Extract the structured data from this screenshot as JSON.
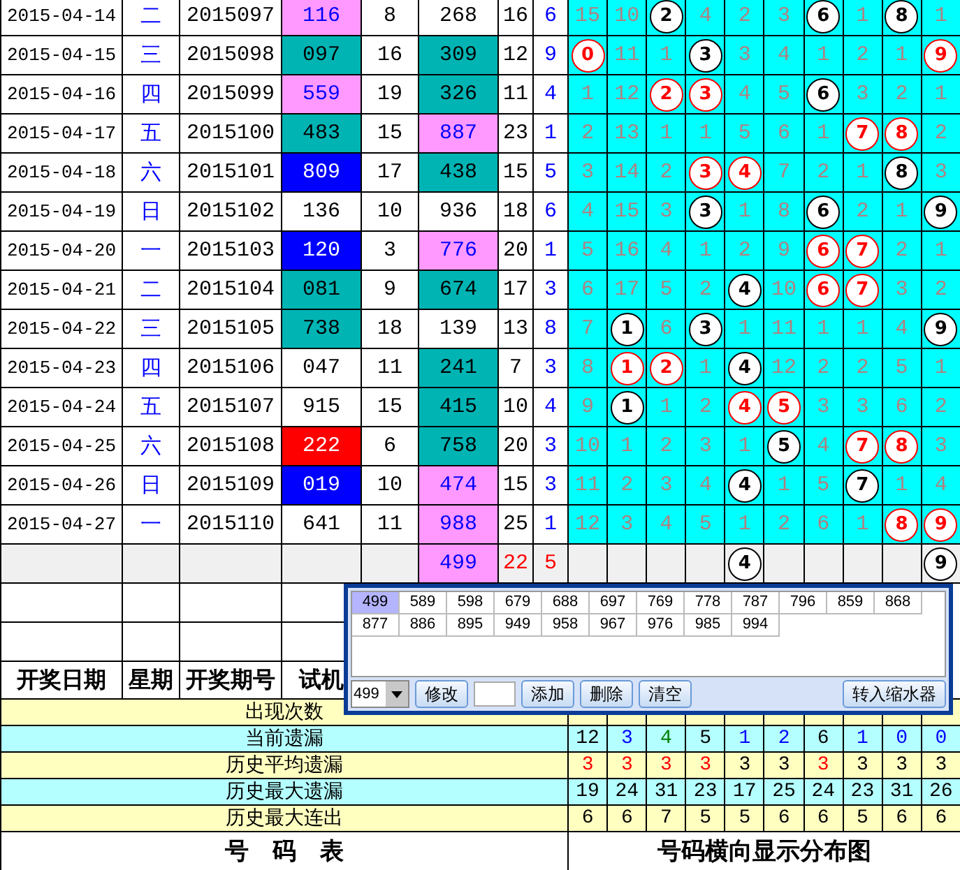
{
  "rows": [
    {
      "date": "2015-04-14",
      "weekday": "二",
      "period": "2015097",
      "trial": {
        "text": "116",
        "color": "#ff99ff"
      },
      "column_5": "8",
      "column_6": {
        "text": "268"
      },
      "column_7": "16",
      "column_8": "6",
      "digits": [
        {
          "text": "15",
          "kind": "miss"
        },
        {
          "text": "10",
          "kind": "miss"
        },
        {
          "text": "2",
          "kind": "ball"
        },
        {
          "text": "4",
          "kind": "miss"
        },
        {
          "text": "2",
          "kind": "miss"
        },
        {
          "text": "3",
          "kind": "miss"
        },
        {
          "text": "6",
          "kind": "ball"
        },
        {
          "text": "1",
          "kind": "miss"
        },
        {
          "text": "8",
          "kind": "ball"
        },
        {
          "text": "1",
          "kind": "miss"
        }
      ]
    },
    {
      "date": "2015-04-15",
      "weekday": "三",
      "period": "2015098",
      "trial": {
        "text": "097",
        "color": "#00b4b4"
      },
      "column_5": "16",
      "column_6": {
        "text": "309",
        "color": "#00b4b4"
      },
      "column_7": "12",
      "column_8": "9",
      "digits": [
        {
          "text": "0",
          "kind": "red-ball"
        },
        {
          "text": "11",
          "kind": "miss"
        },
        {
          "text": "1",
          "kind": "miss"
        },
        {
          "text": "3",
          "kind": "ball"
        },
        {
          "text": "3",
          "kind": "miss"
        },
        {
          "text": "4",
          "kind": "miss"
        },
        {
          "text": "1",
          "kind": "miss"
        },
        {
          "text": "2",
          "kind": "miss"
        },
        {
          "text": "1",
          "kind": "miss"
        },
        {
          "text": "9",
          "kind": "red-ball"
        }
      ]
    },
    {
      "date": "2015-04-16",
      "weekday": "四",
      "period": "2015099",
      "trial": {
        "text": "559",
        "color": "#ff99ff"
      },
      "column_5": "19",
      "column_6": {
        "text": "326",
        "color": "#00b4b4"
      },
      "column_7": "11",
      "column_8": "4",
      "digits": [
        {
          "text": "1",
          "kind": "miss"
        },
        {
          "text": "12",
          "kind": "miss"
        },
        {
          "text": "2",
          "kind": "red-ball"
        },
        {
          "text": "3",
          "kind": "red-ball"
        },
        {
          "text": "4",
          "kind": "miss"
        },
        {
          "text": "5",
          "kind": "miss"
        },
        {
          "text": "6",
          "kind": "ball"
        },
        {
          "text": "3",
          "kind": "miss"
        },
        {
          "text": "2",
          "kind": "miss"
        },
        {
          "text": "1",
          "kind": "miss"
        }
      ]
    },
    {
      "date": "2015-04-17",
      "weekday": "五",
      "period": "2015100",
      "trial": {
        "text": "483",
        "color": "#00b4b4"
      },
      "column_5": "15",
      "column_6": {
        "text": "887",
        "color": "#ff99ff"
      },
      "column_7": "23",
      "column_8": "1",
      "digits": [
        {
          "text": "2",
          "kind": "miss"
        },
        {
          "text": "13",
          "kind": "miss"
        },
        {
          "text": "1",
          "kind": "miss"
        },
        {
          "text": "1",
          "kind": "miss"
        },
        {
          "text": "5",
          "kind": "miss"
        },
        {
          "text": "6",
          "kind": "miss"
        },
        {
          "text": "1",
          "kind": "miss"
        },
        {
          "text": "7",
          "kind": "red-ball"
        },
        {
          "text": "8",
          "kind": "red-ball"
        },
        {
          "text": "2",
          "kind": "miss"
        }
      ]
    },
    {
      "date": "2015-04-18",
      "weekday": "六",
      "period": "2015101",
      "trial": {
        "text": "809",
        "color": "#0000ff"
      },
      "column_5": "17",
      "column_6": {
        "text": "438",
        "color": "#00b4b4"
      },
      "column_7": "15",
      "column_8": "5",
      "digits": [
        {
          "text": "3",
          "kind": "miss"
        },
        {
          "text": "14",
          "kind": "miss"
        },
        {
          "text": "2",
          "kind": "miss"
        },
        {
          "text": "3",
          "kind": "red-ball"
        },
        {
          "text": "4",
          "kind": "red-ball"
        },
        {
          "text": "7",
          "kind": "miss"
        },
        {
          "text": "2",
          "kind": "miss"
        },
        {
          "text": "1",
          "kind": "miss"
        },
        {
          "text": "8",
          "kind": "ball"
        },
        {
          "text": "3",
          "kind": "miss"
        }
      ]
    },
    {
      "date": "2015-04-19",
      "weekday": "日",
      "period": "2015102",
      "trial": {
        "text": "136"
      },
      "column_5": "10",
      "column_6": {
        "text": "936"
      },
      "column_7": "18",
      "column_8": "6",
      "digits": [
        {
          "text": "4",
          "kind": "miss"
        },
        {
          "text": "15",
          "kind": "miss"
        },
        {
          "text": "3",
          "kind": "miss"
        },
        {
          "text": "3",
          "kind": "ball"
        },
        {
          "text": "1",
          "kind": "miss"
        },
        {
          "text": "8",
          "kind": "miss"
        },
        {
          "text": "6",
          "kind": "ball"
        },
        {
          "text": "2",
          "kind": "miss"
        },
        {
          "text": "1",
          "kind": "miss"
        },
        {
          "text": "9",
          "kind": "ball"
        }
      ]
    },
    {
      "date": "2015-04-20",
      "weekday": "一",
      "period": "2015103",
      "trial": {
        "text": "120",
        "color": "#0000ff"
      },
      "column_5": "3",
      "column_6": {
        "text": "776",
        "color": "#ff99ff"
      },
      "column_7": "20",
      "column_8": "1",
      "digits": [
        {
          "text": "5",
          "kind": "miss"
        },
        {
          "text": "16",
          "kind": "miss"
        },
        {
          "text": "4",
          "kind": "miss"
        },
        {
          "text": "1",
          "kind": "miss"
        },
        {
          "text": "2",
          "kind": "miss"
        },
        {
          "text": "9",
          "kind": "miss"
        },
        {
          "text": "6",
          "kind": "red-ball"
        },
        {
          "text": "7",
          "kind": "red-ball"
        },
        {
          "text": "2",
          "kind": "miss"
        },
        {
          "text": "1",
          "kind": "miss"
        }
      ]
    },
    {
      "date": "2015-04-21",
      "weekday": "二",
      "period": "2015104",
      "trial": {
        "text": "081",
        "color": "#00b4b4"
      },
      "column_5": "9",
      "column_6": {
        "text": "674",
        "color": "#00b4b4"
      },
      "column_7": "17",
      "column_8": "3",
      "digits": [
        {
          "text": "6",
          "kind": "miss"
        },
        {
          "text": "17",
          "kind": "miss"
        },
        {
          "text": "5",
          "kind": "miss"
        },
        {
          "text": "2",
          "kind": "miss"
        },
        {
          "text": "4",
          "kind": "ball"
        },
        {
          "text": "10",
          "kind": "miss"
        },
        {
          "text": "6",
          "kind": "red-ball"
        },
        {
          "text": "7",
          "kind": "red-ball"
        },
        {
          "text": "3",
          "kind": "miss"
        },
        {
          "text": "2",
          "kind": "miss"
        }
      ]
    },
    {
      "date": "2015-04-22",
      "weekday": "三",
      "period": "2015105",
      "trial": {
        "text": "738",
        "color": "#00b4b4"
      },
      "column_5": "18",
      "column_6": {
        "text": "139"
      },
      "column_7": "13",
      "column_8": "8",
      "digits": [
        {
          "text": "7",
          "kind": "miss"
        },
        {
          "text": "1",
          "kind": "ball"
        },
        {
          "text": "6",
          "kind": "miss"
        },
        {
          "text": "3",
          "kind": "ball"
        },
        {
          "text": "1",
          "kind": "miss"
        },
        {
          "text": "11",
          "kind": "miss"
        },
        {
          "text": "1",
          "kind": "miss"
        },
        {
          "text": "1",
          "kind": "miss"
        },
        {
          "text": "4",
          "kind": "miss"
        },
        {
          "text": "9",
          "kind": "ball"
        }
      ]
    },
    {
      "date": "2015-04-23",
      "weekday": "四",
      "period": "2015106",
      "trial": {
        "text": "047"
      },
      "column_5": "11",
      "column_6": {
        "text": "241",
        "color": "#00b4b4"
      },
      "column_7": "7",
      "column_8": "3",
      "digits": [
        {
          "text": "8",
          "kind": "miss"
        },
        {
          "text": "1",
          "kind": "red-ball"
        },
        {
          "text": "2",
          "kind": "red-ball"
        },
        {
          "text": "1",
          "kind": "miss"
        },
        {
          "text": "4",
          "kind": "ball"
        },
        {
          "text": "12",
          "kind": "miss"
        },
        {
          "text": "2",
          "kind": "miss"
        },
        {
          "text": "2",
          "kind": "miss"
        },
        {
          "text": "5",
          "kind": "miss"
        },
        {
          "text": "1",
          "kind": "miss"
        }
      ]
    },
    {
      "date": "2015-04-24",
      "weekday": "五",
      "period": "2015107",
      "trial": {
        "text": "915"
      },
      "column_5": "15",
      "column_6": {
        "text": "415",
        "color": "#00b4b4"
      },
      "column_7": "10",
      "column_8": "4",
      "digits": [
        {
          "text": "9",
          "kind": "miss"
        },
        {
          "text": "1",
          "kind": "ball"
        },
        {
          "text": "1",
          "kind": "miss"
        },
        {
          "text": "2",
          "kind": "miss"
        },
        {
          "text": "4",
          "kind": "red-ball"
        },
        {
          "text": "5",
          "kind": "red-ball"
        },
        {
          "text": "3",
          "kind": "miss"
        },
        {
          "text": "3",
          "kind": "miss"
        },
        {
          "text": "6",
          "kind": "miss"
        },
        {
          "text": "2",
          "kind": "miss"
        }
      ]
    },
    {
      "date": "2015-04-25",
      "weekday": "六",
      "period": "2015108",
      "trial": {
        "text": "222",
        "color": "#ff0000"
      },
      "column_5": "6",
      "column_6": {
        "text": "758",
        "color": "#00b4b4"
      },
      "column_7": "20",
      "column_8": "3",
      "digits": [
        {
          "text": "10",
          "kind": "miss"
        },
        {
          "text": "1",
          "kind": "miss"
        },
        {
          "text": "2",
          "kind": "miss"
        },
        {
          "text": "3",
          "kind": "miss"
        },
        {
          "text": "1",
          "kind": "miss"
        },
        {
          "text": "5",
          "kind": "ball"
        },
        {
          "text": "4",
          "kind": "miss"
        },
        {
          "text": "7",
          "kind": "red-ball"
        },
        {
          "text": "8",
          "kind": "red-ball"
        },
        {
          "text": "3",
          "kind": "miss"
        }
      ]
    },
    {
      "date": "2015-04-26",
      "weekday": "日",
      "period": "2015109",
      "trial": {
        "text": "019",
        "color": "#0000ff"
      },
      "column_5": "10",
      "column_6": {
        "text": "474",
        "color": "#ff99ff"
      },
      "column_7": "15",
      "column_8": "3",
      "digits": [
        {
          "text": "11",
          "kind": "miss"
        },
        {
          "text": "2",
          "kind": "miss"
        },
        {
          "text": "3",
          "kind": "miss"
        },
        {
          "text": "4",
          "kind": "miss"
        },
        {
          "text": "4",
          "kind": "ball"
        },
        {
          "text": "1",
          "kind": "miss"
        },
        {
          "text": "5",
          "kind": "miss"
        },
        {
          "text": "7",
          "kind": "ball"
        },
        {
          "text": "1",
          "kind": "miss"
        },
        {
          "text": "4",
          "kind": "miss"
        }
      ]
    },
    {
      "date": "2015-04-27",
      "weekday": "一",
      "period": "2015110",
      "trial": {
        "text": "641"
      },
      "column_5": "11",
      "column_6": {
        "text": "988",
        "color": "#ff99ff"
      },
      "column_7": "25",
      "column_8": "1",
      "digits": [
        {
          "text": "12",
          "kind": "miss"
        },
        {
          "text": "3",
          "kind": "miss"
        },
        {
          "text": "4",
          "kind": "miss"
        },
        {
          "text": "5",
          "kind": "miss"
        },
        {
          "text": "1",
          "kind": "miss"
        },
        {
          "text": "2",
          "kind": "miss"
        },
        {
          "text": "6",
          "kind": "miss"
        },
        {
          "text": "1",
          "kind": "miss"
        },
        {
          "text": "8",
          "kind": "red-ball"
        },
        {
          "text": "9",
          "kind": "red-ball"
        }
      ]
    }
  ],
  "summary": {
    "column_6": {
      "text": "499",
      "color": "#ff99ff"
    },
    "column_7": "22",
    "column_8": "5",
    "digits": [
      {
        "kind": "empty"
      },
      {
        "kind": "empty"
      },
      {
        "kind": "empty"
      },
      {
        "kind": "empty"
      },
      {
        "text": "4",
        "kind": "ball"
      },
      {
        "kind": "empty"
      },
      {
        "kind": "empty"
      },
      {
        "kind": "empty"
      },
      {
        "kind": "empty"
      },
      {
        "text": "9",
        "kind": "ball"
      }
    ]
  },
  "header": [
    "开奖日期",
    "星期",
    "开奖期号",
    "试机"
  ],
  "stats": [
    {
      "label": "出现次数"
    },
    {
      "label": "当前遗漏",
      "values": [
        {
          "text": "12",
          "color": "#000000"
        },
        {
          "text": "3",
          "color": "#0000ff"
        },
        {
          "text": "4",
          "color": "#008000"
        },
        {
          "text": "5",
          "color": "#000000"
        },
        {
          "text": "1",
          "color": "#0000ff"
        },
        {
          "text": "2",
          "color": "#0000ff"
        },
        {
          "text": "6",
          "color": "#000000"
        },
        {
          "text": "1",
          "color": "#0000ff"
        },
        {
          "text": "0",
          "color": "#0000ff"
        },
        {
          "text": "0",
          "color": "#0000ff"
        }
      ]
    },
    {
      "label": "历史平均遗漏",
      "values": [
        {
          "text": "3",
          "color": "#ff0000"
        },
        {
          "text": "3",
          "color": "#ff0000"
        },
        {
          "text": "3",
          "color": "#ff0000"
        },
        {
          "text": "3",
          "color": "#ff0000"
        },
        {
          "text": "3",
          "color": "#000000"
        },
        {
          "text": "3",
          "color": "#000000"
        },
        {
          "text": "3",
          "color": "#ff0000"
        },
        {
          "text": "3",
          "color": "#000000"
        },
        {
          "text": "3",
          "color": "#000000"
        },
        {
          "text": "3",
          "color": "#000000"
        }
      ]
    },
    {
      "label": "历史最大遗漏",
      "values": [
        {
          "text": "19",
          "color": "#000000"
        },
        {
          "text": "24",
          "color": "#000000"
        },
        {
          "text": "31",
          "color": "#000000"
        },
        {
          "text": "23",
          "color": "#000000"
        },
        {
          "text": "17",
          "color": "#000000"
        },
        {
          "text": "25",
          "color": "#000000"
        },
        {
          "text": "24",
          "color": "#000000"
        },
        {
          "text": "23",
          "color": "#000000"
        },
        {
          "text": "31",
          "color": "#000000"
        },
        {
          "text": "26",
          "color": "#000000"
        }
      ]
    },
    {
      "label": "历史最大连出",
      "values": [
        {
          "text": "6",
          "color": "#000000"
        },
        {
          "text": "6",
          "color": "#000000"
        },
        {
          "text": "7",
          "color": "#000000"
        },
        {
          "text": "5",
          "color": "#000000"
        },
        {
          "text": "5",
          "color": "#000000"
        },
        {
          "text": "6",
          "color": "#000000"
        },
        {
          "text": "6",
          "color": "#000000"
        },
        {
          "text": "5",
          "color": "#000000"
        },
        {
          "text": "6",
          "color": "#000000"
        },
        {
          "text": "6",
          "color": "#000000"
        }
      ]
    }
  ],
  "footer": {
    "left": "号　码　表",
    "right": "号码横向显示分布图"
  },
  "popup": {
    "items": [
      {
        "text": "499",
        "selected": true
      },
      {
        "text": "589",
        "selected": false
      },
      {
        "text": "598",
        "selected": false
      },
      {
        "text": "679",
        "selected": false
      },
      {
        "text": "688",
        "selected": false
      },
      {
        "text": "697",
        "selected": false
      },
      {
        "text": "769",
        "selected": false
      },
      {
        "text": "778",
        "selected": false
      },
      {
        "text": "787",
        "selected": false
      },
      {
        "text": "796",
        "selected": false
      },
      {
        "text": "859",
        "selected": false
      },
      {
        "text": "868",
        "selected": false
      },
      {
        "text": "877",
        "selected": false
      },
      {
        "text": "886",
        "selected": false
      },
      {
        "text": "895",
        "selected": false
      },
      {
        "text": "949",
        "selected": false
      },
      {
        "text": "958",
        "selected": false
      },
      {
        "text": "967",
        "selected": false
      },
      {
        "text": "976",
        "selected": false
      },
      {
        "text": "985",
        "selected": false
      },
      {
        "text": "994",
        "selected": false
      }
    ],
    "combo": "499",
    "modify_button": "修改",
    "add_button": "添加",
    "delete_button": "删除",
    "clear_button": "清空",
    "transfer_button": "转入缩水器"
  }
}
